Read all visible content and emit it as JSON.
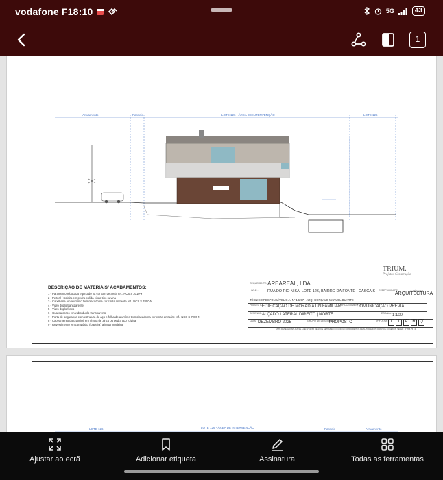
{
  "status_bar": {
    "carrier_time": "vodafone F18:10",
    "network": "5G",
    "battery": "43"
  },
  "toolbar": {
    "back_icon": "arrow-left-icon",
    "tools": [
      "share-icon",
      "reader-mode-icon",
      "page-count-icon"
    ],
    "page_number": "1"
  },
  "document": {
    "lot_label": "LOTE 126 - ÁREA DE INTERVENÇÃO",
    "lot_label_right": "LOTE 126",
    "arruamento": "Arruamento",
    "passeio": "Passeio",
    "materials_title": "DESCRIÇÃO DE MATERIAIS/ ACABAMENTOS:",
    "materials": [
      "1 - Paramento rebocado e pintado na cor tom de areia ref.: NCS S 3010-Y",
      "2 - Peitoril / Soleira em pedra polida cinza tipo ruivina",
      "3 - Caixilharia em alumínio termolacado na cor cinza antracite ref.: NCS S 7000-N",
      "4 - Vidro duplo transparente",
      "5 - Vidro duplo fosco",
      "6 - Guarda corpo em vidro duplo transparente",
      "7 - Porta de segurança com estrutura de aço e folha de alumínio termolacado na cor cinza antracite ref.: NCS S 7000-N",
      "8 - Capeamento da chaminé em chapa de zinco ou pedra tipo ruivina",
      "9 - Revestimento em compósito (ipadeira) a imitar madeira"
    ],
    "logo": "TRIUM.",
    "logo_sub": "Projetos Construção",
    "title_block": {
      "requerente_label": "REQUERENTE:",
      "requerente": "AREAREAL, LDA.",
      "local_label": "LOCAL:",
      "local": "RUA DO RIO NISA, LOTE 126, BAIRRO DA FONTE - CASCAIS",
      "especialidade_label": "ESPECIALIDADE:",
      "especialidade": "ARQUITECTURA",
      "tecnico": "TÉCNICO RESPONSÁVEL O.A. Nº 13297 - ARQ. GONÇALO MANUEL DUARTE",
      "projecto_label": "PROJECTO:",
      "projecto": "EDIFICAÇÃO DE MORADIA UNIFAMILIAR",
      "procedimento_label": "PROCEDIMENTO:",
      "procedimento": "COMUNICAÇÃO PRÉVIA",
      "desenho_label": "DESENHO:",
      "desenho": "ALÇADO LATERAL DIREITO | NORTE",
      "escala_label": "ESCALA:",
      "escala": "1:100",
      "data_label": "DATA:",
      "data": "DEZEMBRO 2025",
      "grupo_label": "GRUPO DE DESENHOS:",
      "grupo": "PROPOSTO",
      "folha_label": "Nº FOLHA:",
      "folha": [
        "1",
        "1",
        "A",
        "R",
        "Q"
      ],
      "tecnico_label": "O TÉCNICO:",
      "footer": "ESTE DESENHO APLICA-SE A LEI Nº 40/86 DE 17 DE SETEMBRO, O CÓDIGO DOS DIREITOS DE AUTOR E DOS DIREITOS CONEXOS. TELEF.: Nº 786 75 13"
    }
  },
  "bottom_bar": {
    "items": [
      {
        "label": "Ajustar ao ecrã",
        "icon": "fit-screen-icon"
      },
      {
        "label": "Adicionar etiqueta",
        "icon": "bookmark-icon"
      },
      {
        "label": "Assinatura",
        "icon": "signature-pen-icon"
      },
      {
        "label": "Todas as ferramentas",
        "icon": "all-tools-grid-icon"
      }
    ]
  }
}
